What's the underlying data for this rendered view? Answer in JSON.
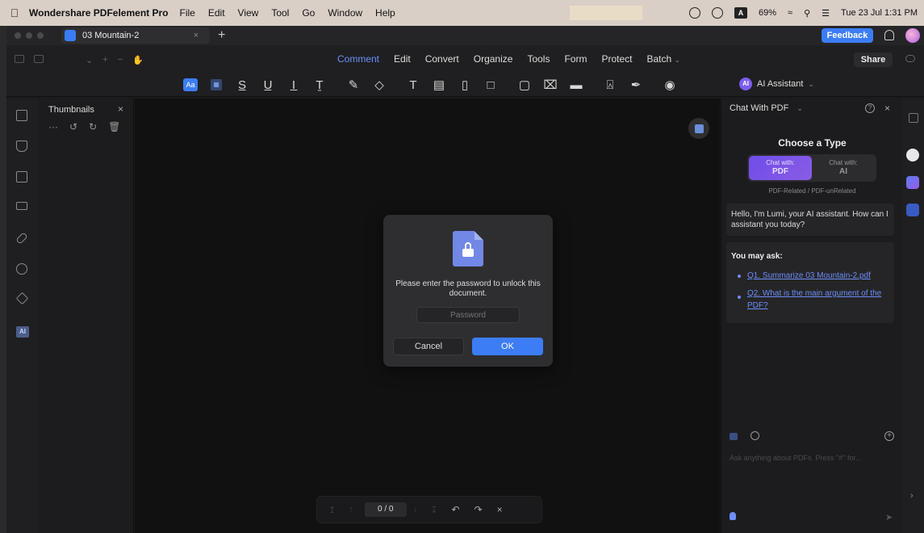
{
  "menubar": {
    "app_name": "Wondershare PDFelement Pro",
    "menus": [
      "File",
      "Edit",
      "View",
      "Tool",
      "Go",
      "Window",
      "Help"
    ],
    "battery": "69%",
    "input_source": "A",
    "datetime": "Tue 23 Jul  1:31 PM"
  },
  "tabbar": {
    "doc_tab": "03 Mountain-2",
    "close": "×",
    "add": "+",
    "feedback": "Feedback"
  },
  "toolbar": {
    "tabs": [
      "Comment",
      "Edit",
      "Convert",
      "Organize",
      "Tools",
      "Form",
      "Protect",
      "Batch"
    ],
    "active_tab": "Comment",
    "share": "Share",
    "ai_badge": "AI",
    "ai_assistant": "AI Assistant"
  },
  "comment_tools": [
    "text-style",
    "area-highlight",
    "strikethrough",
    "underline",
    "insert-text",
    "replace-text",
    "pencil",
    "eraser",
    "text-box",
    "text-field",
    "callout",
    "note",
    "shape",
    "attachment",
    "measure",
    "stamp",
    "signature",
    "show-comments"
  ],
  "thumbnails": {
    "title": "Thumbnails",
    "close": "×",
    "more": "···"
  },
  "rail": {
    "ai": "AI"
  },
  "dialog": {
    "message": "Please enter the password to unlock this document.",
    "password_placeholder": "Password",
    "cancel": "Cancel",
    "ok": "OK"
  },
  "pagebar": {
    "page": "0 / 0"
  },
  "chat": {
    "mode": "Chat With PDF",
    "help": "?",
    "close": "×",
    "choose_title": "Choose a Type",
    "option_pdf_top": "Chat with:",
    "option_pdf": "PDF",
    "option_ai_top": "Chat with:",
    "option_ai": "AI",
    "option_sub": "PDF-Related / PDF-unRelated",
    "greeting": "Hello, I'm Lumi, your AI assistant. How can I assistant you today?",
    "you_may_ask": "You may ask:",
    "q1": "Q1. Summarize 03 Mountain-2.pdf",
    "q2": "Q2. What is the main argument of the PDF?",
    "input_placeholder": "Ask anything about PDFs. Press \"#\" for...",
    "plus": "+"
  },
  "colors": {
    "accent": "#3c7df6",
    "link": "#6d8ef8",
    "ai_gradient": "#7a5cf0"
  }
}
